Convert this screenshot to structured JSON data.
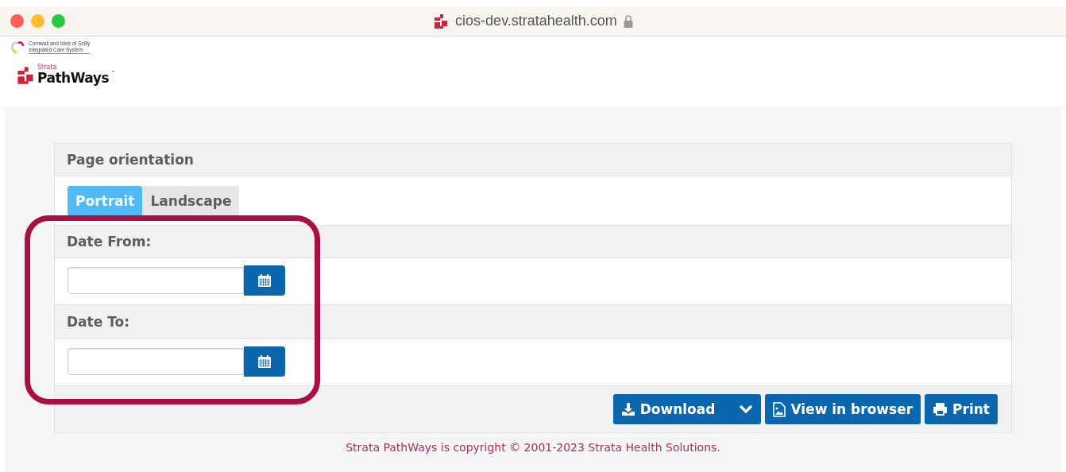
{
  "browser": {
    "url": "cios-dev.stratahealth.com"
  },
  "header": {
    "ics_logo": [
      "Cornwall and Isles of Scilly",
      "Integrated Care System"
    ],
    "brand_small": "Strata",
    "brand": "PathWays",
    "brand_mark": "™"
  },
  "panel": {
    "orientation_title": "Page orientation",
    "tabs": [
      {
        "label": "Portrait",
        "selected": true
      },
      {
        "label": "Landscape",
        "selected": false
      }
    ],
    "date_fields": [
      {
        "label": "Date From:"
      },
      {
        "label": "Date To:"
      }
    ],
    "buttons": [
      {
        "kind": "download",
        "label": "Download"
      },
      {
        "kind": "view",
        "label": "View in browser"
      },
      {
        "kind": "print",
        "label": "Print"
      }
    ]
  },
  "footer": "Strata PathWays is copyright © 2001-2023 Strata Health Solutions."
}
